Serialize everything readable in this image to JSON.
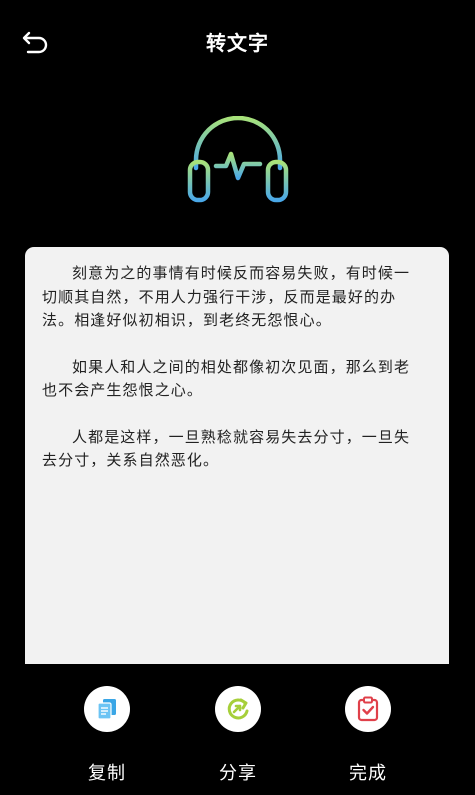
{
  "header": {
    "title": "转文字",
    "back_icon": "back-arrow-icon"
  },
  "icon": {
    "name": "headphone-waveform-icon",
    "gradient_start": "#a8e27a",
    "gradient_end": "#4aa8e8"
  },
  "content": {
    "paragraphs": [
      "刻意为之的事情有时候反而容易失败，有时候一切顺其自然，不用人力强行干涉，反而是最好的办法。相逢好似初相识，到老终无怨恨心。",
      "如果人和人之间的相处都像初次见面，那么到老也不会产生怨恨之心。",
      "人都是这样，一旦熟稔就容易失去分寸，一旦失去分寸，关系自然恶化。"
    ]
  },
  "actions": {
    "copy": {
      "label": "复制",
      "icon": "copy-icon",
      "color": "#3aa6e6"
    },
    "share": {
      "label": "分享",
      "icon": "share-icon",
      "color": "#a6cf3a"
    },
    "done": {
      "label": "完成",
      "icon": "done-clipboard-icon",
      "color": "#e0404a"
    }
  }
}
